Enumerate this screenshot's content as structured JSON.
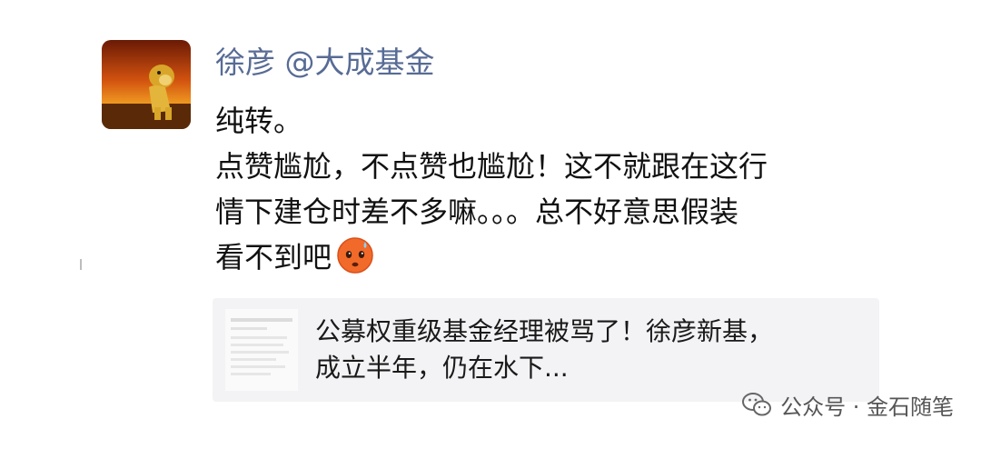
{
  "post": {
    "author": "徐彦 @大成基金",
    "lines": [
      "纯转。",
      "点赞尴尬，不点赞也尴尬！这不就跟在这行",
      "情下建仓时差不多嘛。。。总不好意思假装",
      "看不到吧"
    ],
    "emoji": "sweat-face-emoji"
  },
  "shared_link": {
    "title_lines": [
      "公募权重级基金经理被骂了！徐彦新基，",
      "成立半年，仍在水下..."
    ]
  },
  "watermark": {
    "icon": "wechat-icon",
    "text": "公众号 · 金石随笔"
  }
}
